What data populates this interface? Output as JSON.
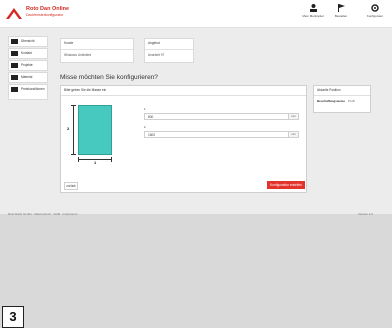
{
  "header": {
    "brand_name": "Roto Dan Online",
    "brand_subtitle": "Dachfensterkonfigurator",
    "actions": [
      {
        "label": "Mein Merkzettel",
        "icon": "person-icon"
      },
      {
        "label": "Bestellen",
        "icon": "flag-icon"
      },
      {
        "label": "Konfigurator",
        "icon": "gear-icon"
      }
    ]
  },
  "sidebar": {
    "items": [
      {
        "label": "Übersicht"
      },
      {
        "label": "Kontakt"
      },
      {
        "label": "Projekte"
      },
      {
        "label": "Material"
      },
      {
        "label": "Preiskonditionen"
      }
    ]
  },
  "info_cards": {
    "client_label": "Kunde",
    "client_value": "Windows Unlimited",
    "offer_label": "Angebot",
    "offer_value": "Anarbeit 97"
  },
  "main": {
    "question": "Misse möchten Sie konfigurieren?",
    "panel_title": "Bitte geben Sie die Masse ein",
    "dim_height_label": "2",
    "dim_width_label": "1",
    "fields": [
      {
        "label": "1",
        "value": "800",
        "unit": "mm"
      },
      {
        "label": "2",
        "value": "1800",
        "unit": "mm"
      }
    ],
    "back_label": "zurück",
    "next_label": "Konfiguration erstellen"
  },
  "side_panel": {
    "title": "Aktuelle Position",
    "row_label": "Beschaffungsweise",
    "row_value": "Profil"
  },
  "footer": {
    "left": "Roto Dach GmbH · Datenschutz · AGB · Impressum",
    "right": "Version 1.0"
  },
  "step_number": "3",
  "colors": {
    "brand_red": "#d32a22",
    "button_red": "#e3342c",
    "shape_teal": "#48c9c0"
  }
}
